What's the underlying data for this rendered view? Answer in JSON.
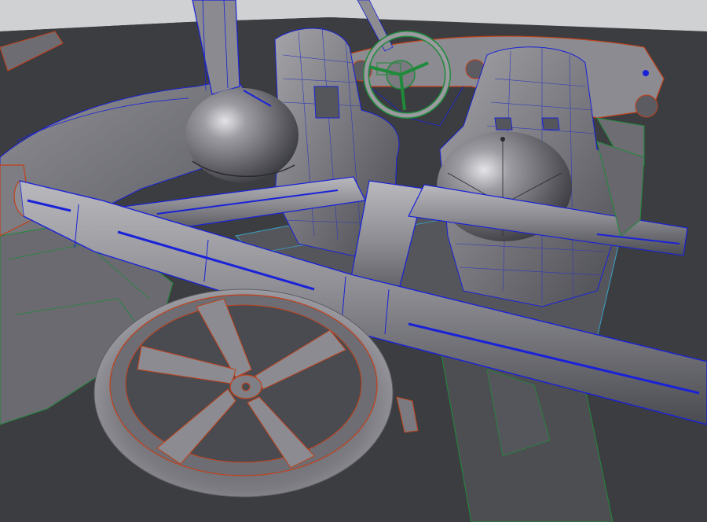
{
  "viewport": {
    "background": "#3b3c3e",
    "backdrop": "#cfd0d2",
    "shade_light": "#9a9a9e",
    "shade_mid": "#77777b",
    "shade_dark": "#4e4f52",
    "wire_blue": "#1a22d8",
    "wire_red": "#c2401a",
    "wire_green": "#1f8a3a",
    "wire_cyan": "#3aa0c8"
  },
  "scene": {
    "objects": [
      {
        "name": "roll-bar",
        "wire": "blue"
      },
      {
        "name": "driver-seat",
        "wire": "blue"
      },
      {
        "name": "passenger-seat",
        "wire": "blue"
      },
      {
        "name": "driver-helmet",
        "wire": "none"
      },
      {
        "name": "passenger-helmet",
        "wire": "none"
      },
      {
        "name": "steering-wheel",
        "wire": "green"
      },
      {
        "name": "dashboard",
        "wire": "red"
      },
      {
        "name": "spare-wheel",
        "wire": "red"
      },
      {
        "name": "floor-frame",
        "wire": "cyan"
      },
      {
        "name": "side-body-panel",
        "wire": "green"
      }
    ]
  }
}
